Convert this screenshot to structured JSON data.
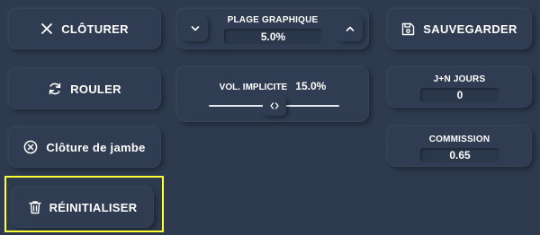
{
  "buttons": {
    "cloturer": {
      "label": "CLÔTURER",
      "icon": "close-icon"
    },
    "rouler": {
      "label": "ROULER",
      "icon": "refresh-icon"
    },
    "cloture_jambe": {
      "label": "Clôture de jambe",
      "icon": "circle-x-icon"
    },
    "reinitialiser": {
      "label": "RÉINITIALISER",
      "icon": "trash-icon"
    },
    "sauvegarder": {
      "label": "SAUVEGARDER",
      "icon": "save-icon"
    }
  },
  "plage": {
    "label": "PLAGE GRAPHIQUE",
    "value": "5.0%"
  },
  "vol": {
    "label": "VOL. IMPLICITE",
    "value": "15.0%",
    "level": 0.5
  },
  "jours": {
    "label": "J+N JOURS",
    "value": "0"
  },
  "commission": {
    "label": "COMMISSION",
    "value": "0.65"
  },
  "colors": {
    "background": "#2e3b4f",
    "highlight": "#ffff33",
    "text": "#ffffff"
  }
}
